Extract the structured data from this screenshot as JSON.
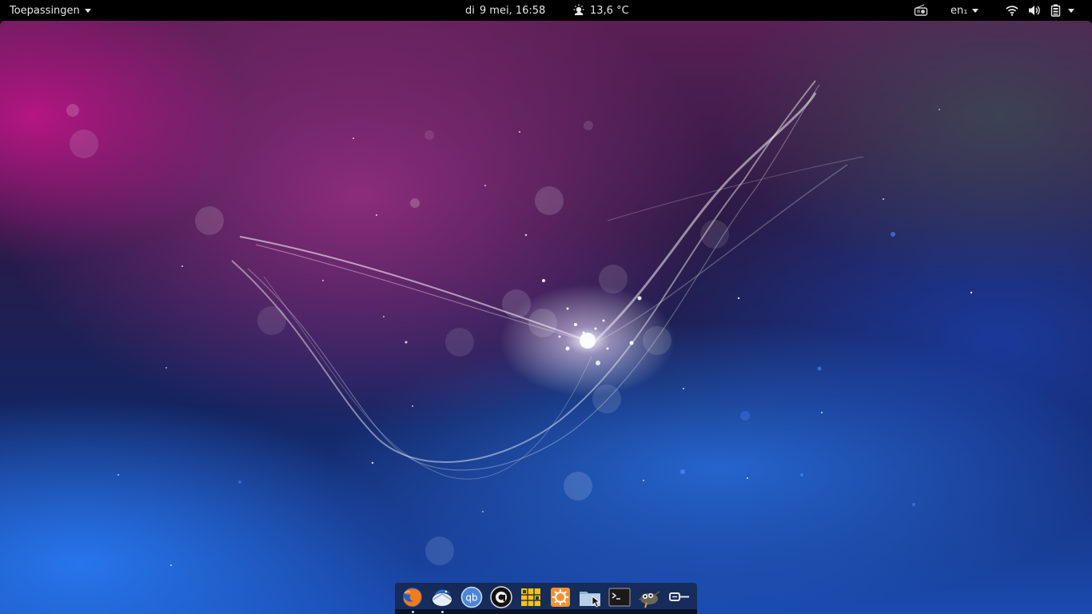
{
  "topbar": {
    "apps_label": "Toepassingen",
    "clock_day": "di",
    "clock_datetime": "9 mei, 16:58",
    "weather_icon": "partly-sunny-icon",
    "weather_temp": "13,6 °C",
    "keyboard_layout": "en₁",
    "status_icons": [
      "radio-icon",
      "wifi-icon",
      "volume-icon",
      "battery-icon",
      "system-menu-caret"
    ]
  },
  "dock": {
    "apps": [
      {
        "name": "Firefox",
        "icon": "firefox-icon",
        "running": true
      },
      {
        "name": "Thunderbird",
        "icon": "thunderbird-icon",
        "running": true
      },
      {
        "name": "qBittorrent",
        "icon": "qbittorrent-icon",
        "running": false
      },
      {
        "name": "Amarok",
        "icon": "amarok-icon",
        "running": false
      },
      {
        "name": "Puzzle",
        "icon": "puzzle-icon",
        "running": false
      },
      {
        "name": "Software Updates",
        "icon": "software-update-icon",
        "running": false
      },
      {
        "name": "Files",
        "icon": "files-icon",
        "running": false
      },
      {
        "name": "Terminal",
        "icon": "terminal-icon",
        "running": false
      },
      {
        "name": "GIMP",
        "icon": "gimp-icon",
        "running": false
      },
      {
        "name": "Connection",
        "icon": "plug-icon",
        "running": false
      }
    ]
  },
  "colors": {
    "topbar_bg": "#000000",
    "topbar_text": "#e6e6e6",
    "wallpaper_magenta": "#c8148c",
    "wallpaper_blue": "#1a4bb0"
  }
}
